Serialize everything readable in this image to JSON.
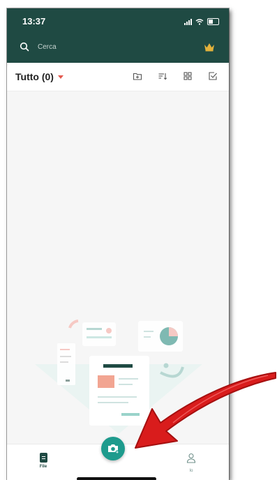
{
  "status": {
    "time": "13:37"
  },
  "search": {
    "placeholder": "Cerca"
  },
  "toolbar": {
    "filter_label": "Tutto (0)"
  },
  "bottom_nav": {
    "file_label": "File",
    "io_label": "Io"
  },
  "colors": {
    "header_bg": "#1f4a43",
    "accent": "#1e9b8d",
    "arrow": "#d91c1c",
    "caret": "#e35a4f",
    "crown": "#e3b23c"
  },
  "icons": {
    "search": "search-icon",
    "premium": "crown-icon",
    "new_folder": "new-folder-icon",
    "sort": "sort-icon",
    "grid": "grid-view-icon",
    "select": "select-icon",
    "camera": "camera-icon",
    "file_nav": "file-icon",
    "profile_nav": "person-icon"
  }
}
